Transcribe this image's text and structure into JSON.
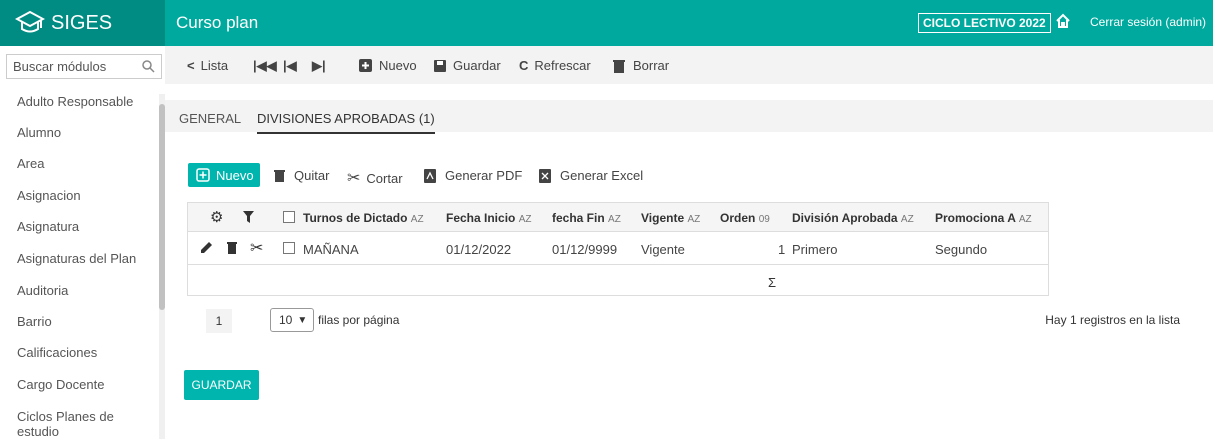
{
  "app": {
    "name": "SIGES"
  },
  "header": {
    "page_title": "Curso plan",
    "ciclo": "CICLO LECTIVO 2022",
    "logout": "Cerrar sesión (admin)"
  },
  "sidebar": {
    "search_placeholder": "Buscar módulos",
    "items": [
      {
        "label": "Adulto Responsable"
      },
      {
        "label": "Alumno"
      },
      {
        "label": "Area"
      },
      {
        "label": "Asignacion"
      },
      {
        "label": "Asignatura"
      },
      {
        "label": "Asignaturas del Plan"
      },
      {
        "label": "Auditoria"
      },
      {
        "label": "Barrio"
      },
      {
        "label": "Calificaciones"
      },
      {
        "label": "Cargo Docente"
      },
      {
        "label": "Ciclos Planes de estudio"
      }
    ]
  },
  "toolbar": {
    "lista": "Lista",
    "nuevo": "Nuevo",
    "guardar": "Guardar",
    "refrescar": "Refrescar",
    "borrar": "Borrar"
  },
  "tabs": [
    {
      "label": "GENERAL",
      "active": false
    },
    {
      "label": "DIVISIONES APROBADAS (1)",
      "active": true
    }
  ],
  "actions": {
    "nuevo": "Nuevo",
    "quitar": "Quitar",
    "cortar": "Cortar",
    "pdf": "Generar PDF",
    "excel": "Generar Excel"
  },
  "grid": {
    "columns": [
      "Turnos de Dictado",
      "Fecha Inicio",
      "fecha Fin",
      "Vigente",
      "Orden",
      "División Aprobada",
      "Promociona A"
    ],
    "rows": [
      {
        "turno": "MAÑANA",
        "fecha_inicio": "01/12/2022",
        "fecha_fin": "01/12/9999",
        "vigente": "Vigente",
        "orden": "1",
        "division": "Primero",
        "promociona": "Segundo"
      }
    ],
    "sum_symbol": "Σ"
  },
  "pager": {
    "page": "1",
    "page_size": "10",
    "page_size_label": "filas por página",
    "count_text": "Hay 1 registros en la lista"
  },
  "save_button": "GUARDAR"
}
